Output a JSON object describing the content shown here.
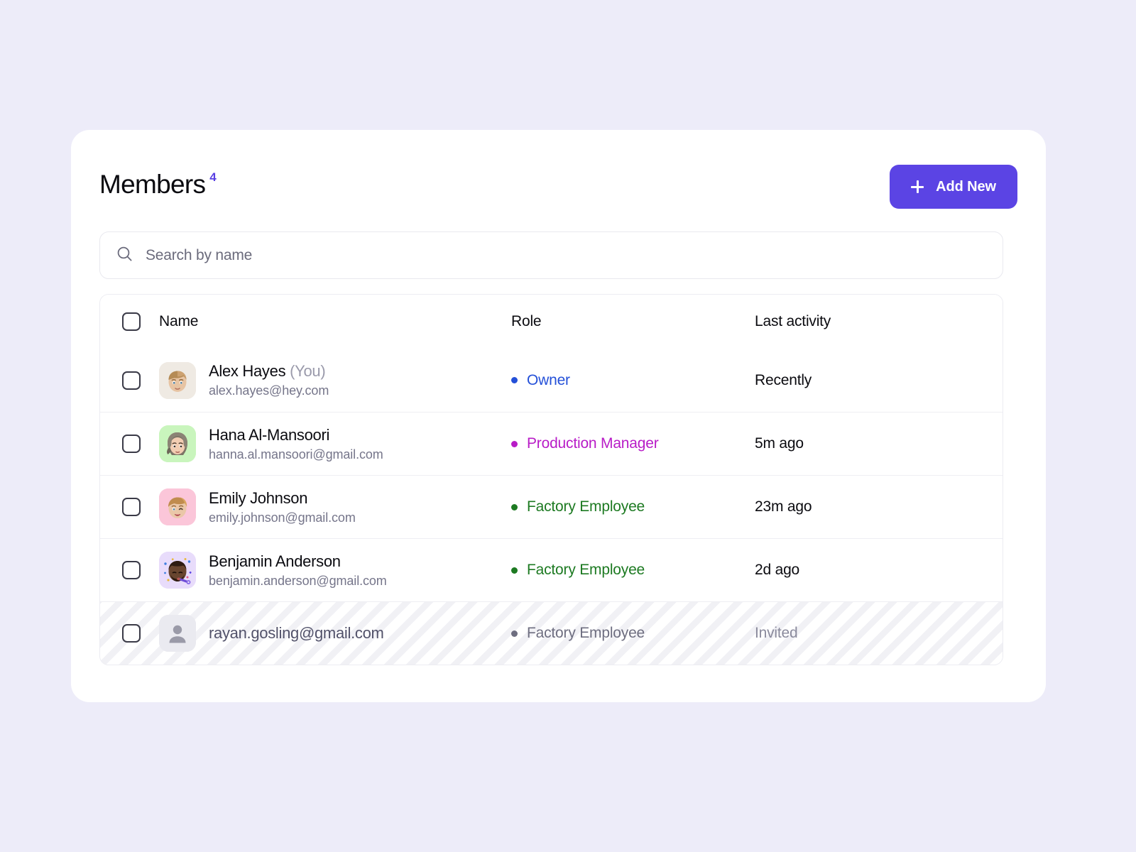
{
  "header": {
    "title": "Members",
    "count": "4",
    "add_button_label": "Add New",
    "add_button_icon": "plus-icon",
    "accent_color": "#5b44e4",
    "count_color": "#5940e3"
  },
  "search": {
    "icon": "search-icon",
    "placeholder": "Search by name",
    "value": ""
  },
  "table": {
    "columns": {
      "name": "Name",
      "role": "Role",
      "activity": "Last activity"
    },
    "rows": [
      {
        "name": "Alex Hayes",
        "suffix": "(You)",
        "email": "alex.hayes@hey.com",
        "role": "Owner",
        "role_color": "#2450d8",
        "activity": "Recently",
        "avatar": "memoji-blonde-man",
        "avatar_bg": "#efeae3",
        "invited": false
      },
      {
        "name": "Hana Al-Mansoori",
        "suffix": "",
        "email": "hanna.al.mansoori@gmail.com",
        "role": "Production Manager",
        "role_color": "#b81cc7",
        "activity": "5m ago",
        "avatar": "memoji-hijab-woman",
        "avatar_bg": "#c9f5bd",
        "invited": false
      },
      {
        "name": "Emily Johnson",
        "suffix": "",
        "email": "emily.johnson@gmail.com",
        "role": "Factory Employee",
        "role_color": "#1d7a22",
        "activity": "23m ago",
        "avatar": "memoji-winking-woman",
        "avatar_bg": "#fbc6d9",
        "invited": false
      },
      {
        "name": "Benjamin Anderson",
        "suffix": "",
        "email": "benjamin.anderson@gmail.com",
        "role": "Factory Employee",
        "role_color": "#1d7a22",
        "activity": "2d ago",
        "avatar": "memoji-party-man",
        "avatar_bg": "#e8dcfb",
        "invited": false
      },
      {
        "name": "",
        "suffix": "",
        "email": "rayan.gosling@gmail.com",
        "role": "Factory Employee",
        "role_color": "#6e6e80",
        "activity": "Invited",
        "avatar": "person-placeholder-icon",
        "avatar_bg": "#eaeaf0",
        "invited": true
      }
    ]
  }
}
